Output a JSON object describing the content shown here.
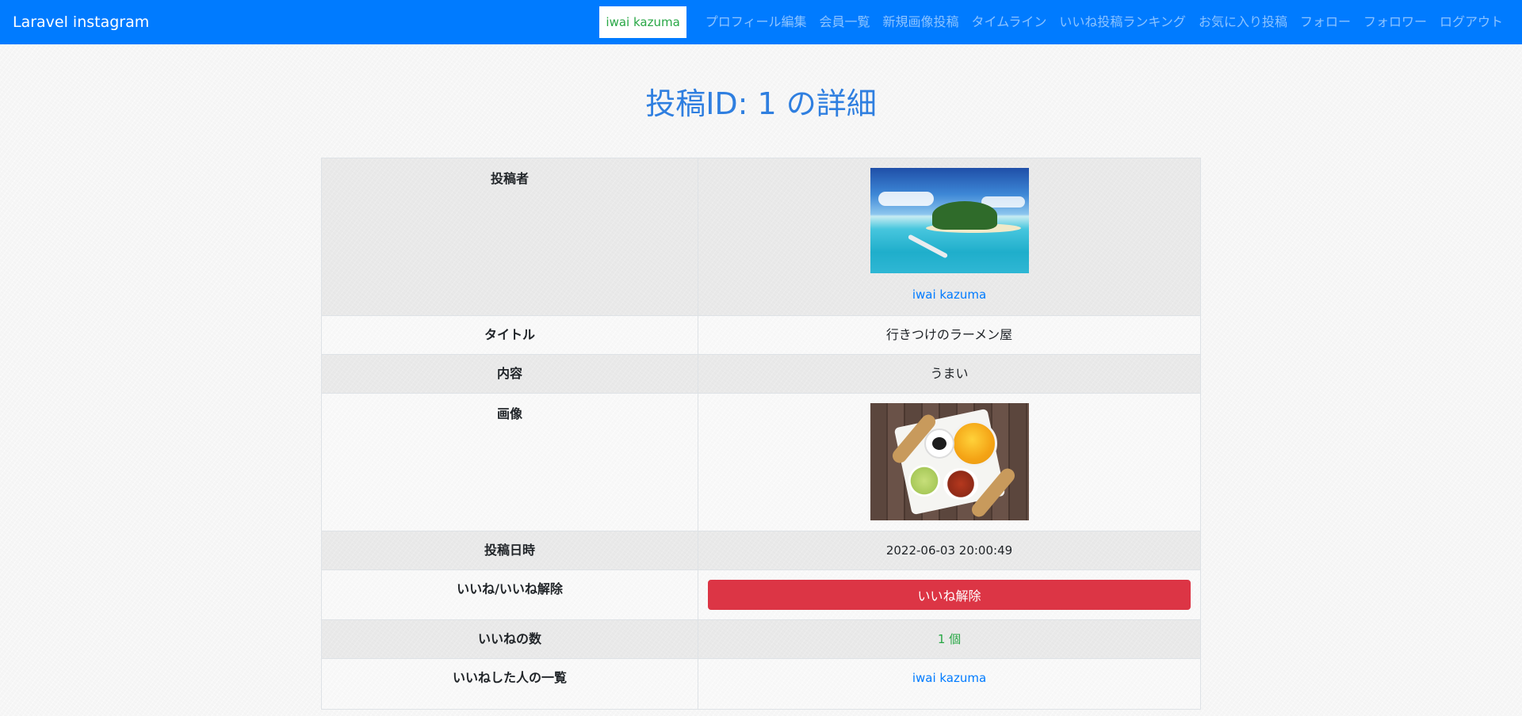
{
  "navbar": {
    "brand": "Laravel instagram",
    "current_user": "iwai kazuma",
    "links": {
      "profile_edit": "プロフィール編集",
      "members": "会員一覧",
      "new_post": "新規画像投稿",
      "timeline": "タイムライン",
      "ranking": "いいね投稿ランキング",
      "favorites": "お気に入り投稿",
      "follow": "フォロー",
      "follower": "フォロワー",
      "logout": "ログアウト"
    }
  },
  "page": {
    "title": "投稿ID: 1 の詳細"
  },
  "detail": {
    "poster_label": "投稿者",
    "poster_name": "iwai kazuma",
    "title_label": "タイトル",
    "title_value": "行きつけのラーメン屋",
    "content_label": "内容",
    "content_value": "うまい",
    "image_label": "画像",
    "date_label": "投稿日時",
    "date_value": "2022-06-03 20:00:49",
    "like_label": "いいね/いいね解除",
    "unlike_button": "いいね解除",
    "like_count_label": "いいねの数",
    "like_count_value": "1 個",
    "likers_label": "いいねした人の一覧",
    "likers": [
      "iwai kazuma"
    ]
  },
  "colors": {
    "navbar": "#007bff",
    "title": "#2f7fe0",
    "link": "#007bff",
    "success": "#28a745",
    "danger": "#dc3545"
  }
}
